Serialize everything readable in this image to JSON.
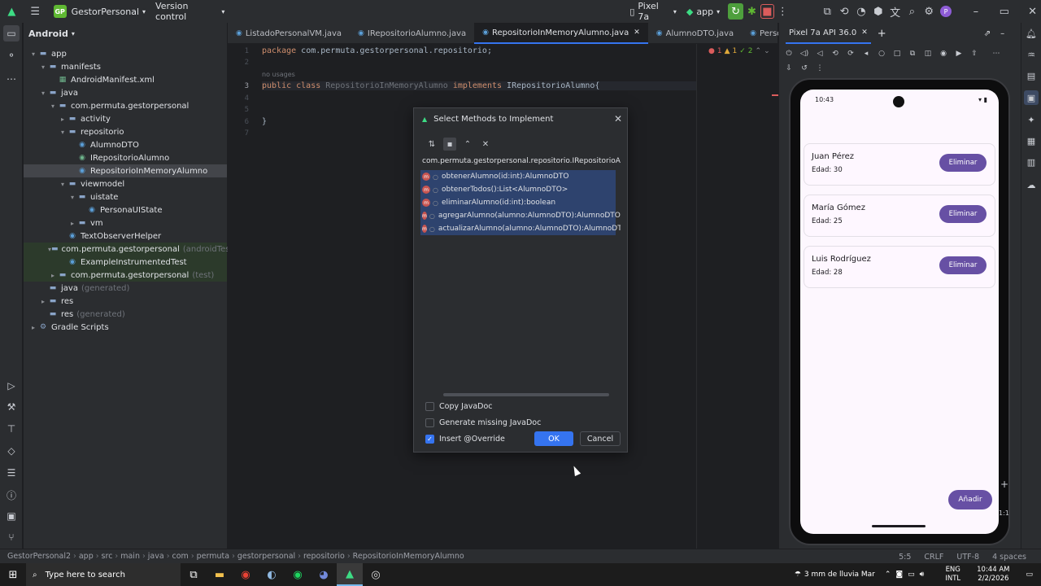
{
  "titlebar": {
    "project_badge": "GP",
    "project": "GestorPersonal",
    "vcs": "Version control",
    "device": "Pixel 7a",
    "run_config": "app",
    "avatar": "P"
  },
  "project_panel": {
    "view": "Android",
    "tree": [
      {
        "label": "app",
        "suffix": "",
        "indent": 0,
        "arrow": "▾",
        "icon": "folder"
      },
      {
        "label": "manifests",
        "suffix": "",
        "indent": 1,
        "arrow": "▾",
        "icon": "folder"
      },
      {
        "label": "AndroidManifest.xml",
        "suffix": "",
        "indent": 2,
        "arrow": "",
        "icon": "manifest"
      },
      {
        "label": "java",
        "suffix": "",
        "indent": 1,
        "arrow": "▾",
        "icon": "folder"
      },
      {
        "label": "com.permuta.gestorpersonal",
        "suffix": "",
        "indent": 2,
        "arrow": "▾",
        "icon": "folder"
      },
      {
        "label": "activity",
        "suffix": "",
        "indent": 3,
        "arrow": "▸",
        "icon": "folder"
      },
      {
        "label": "repositorio",
        "suffix": "",
        "indent": 3,
        "arrow": "▾",
        "icon": "folder"
      },
      {
        "label": "AlumnoDTO",
        "suffix": "",
        "indent": 4,
        "arrow": "",
        "icon": "class"
      },
      {
        "label": "IRepositorioAlumno",
        "suffix": "",
        "indent": 4,
        "arrow": "",
        "icon": "interface"
      },
      {
        "label": "RepositorioInMemoryAlumno",
        "suffix": "",
        "indent": 4,
        "arrow": "",
        "icon": "class",
        "selected": true
      },
      {
        "label": "viewmodel",
        "suffix": "",
        "indent": 3,
        "arrow": "▾",
        "icon": "folder"
      },
      {
        "label": "uistate",
        "suffix": "",
        "indent": 4,
        "arrow": "▾",
        "icon": "folder"
      },
      {
        "label": "PersonaUIState",
        "suffix": "",
        "indent": 5,
        "arrow": "",
        "icon": "class"
      },
      {
        "label": "vm",
        "suffix": "",
        "indent": 4,
        "arrow": "▸",
        "icon": "folder"
      },
      {
        "label": "TextObserverHelper",
        "suffix": "",
        "indent": 3,
        "arrow": "",
        "icon": "class"
      },
      {
        "label": "com.permuta.gestorpersonal",
        "suffix": "(androidTest)",
        "indent": 2,
        "arrow": "▾",
        "icon": "folder",
        "test": true
      },
      {
        "label": "ExampleInstrumentedTest",
        "suffix": "",
        "indent": 3,
        "arrow": "",
        "icon": "class",
        "test": true
      },
      {
        "label": "com.permuta.gestorpersonal",
        "suffix": "(test)",
        "indent": 2,
        "arrow": "▸",
        "icon": "folder",
        "test": true
      },
      {
        "label": "java",
        "suffix": "(generated)",
        "indent": 1,
        "arrow": "",
        "icon": "folder"
      },
      {
        "label": "res",
        "suffix": "",
        "indent": 1,
        "arrow": "▸",
        "icon": "folder"
      },
      {
        "label": "res",
        "suffix": "(generated)",
        "indent": 1,
        "arrow": "",
        "icon": "folder"
      },
      {
        "label": "Gradle Scripts",
        "suffix": "",
        "indent": 0,
        "arrow": "▸",
        "icon": "gradle"
      }
    ]
  },
  "editor": {
    "tabs": [
      "ListadoPersonalVM.java",
      "IRepositorioAlumno.java",
      "RepositorioInMemoryAlumno.java",
      "AlumnoDTO.java",
      "PersonaU"
    ],
    "active_tab": 2,
    "line_numbers": [
      "1",
      "2",
      "",
      "3",
      "4",
      "5",
      "6",
      "7"
    ],
    "code": {
      "line1_kw": "package",
      "line1_rest": " com.permuta.gestorpersonal.repositorio;",
      "usages": "no usages",
      "line3_kw1": "public class",
      "line3_name": " RepositorioInMemoryAlumno",
      "line3_kw2": " implements",
      "line3_iface": " IRepositorioAlumno{",
      "line6": "}"
    },
    "inspections": {
      "errors": "1",
      "warnings": "1",
      "weak": "2"
    }
  },
  "dialog": {
    "title": "Select Methods to Implement",
    "root": "com.permuta.gestorpersonal.repositorio.IRepositorioAlumno",
    "methods": [
      "obtenerAlumno(id:int):AlumnoDTO",
      "obtenerTodos():List<AlumnoDTO>",
      "eliminarAlumno(id:int):boolean",
      "agregarAlumno(alumno:AlumnoDTO):AlumnoDTO",
      "actualizarAlumno(alumno:AlumnoDTO):AlumnoDTO"
    ],
    "copy_javadoc": "Copy JavaDoc",
    "generate_javadoc": "Generate missing JavaDoc",
    "insert_override": "Insert @Override",
    "insert_override_checked": true,
    "ok": "OK",
    "cancel": "Cancel"
  },
  "emulator": {
    "tab": "Pixel 7a API 36.0",
    "status_time": "10:43",
    "people": [
      {
        "name": "Juan Pérez",
        "age": "Edad: 30",
        "action": "Eliminar"
      },
      {
        "name": "María Gómez",
        "age": "Edad: 25",
        "action": "Eliminar"
      },
      {
        "name": "Luis Rodríguez",
        "age": "Edad: 28",
        "action": "Eliminar"
      }
    ],
    "add_button": "Añadir",
    "zoom": "1:1"
  },
  "breadcrumb": [
    "GestorPersonal2",
    "app",
    "src",
    "main",
    "java",
    "com",
    "permuta",
    "gestorpersonal",
    "repositorio",
    "RepositorioInMemoryAlumno"
  ],
  "statusbar": {
    "position": "5:5",
    "line_sep": "CRLF",
    "encoding": "UTF-8",
    "indent": "4 spaces"
  },
  "taskbar": {
    "search_placeholder": "Type here to search",
    "weather": "3 mm de lluvia Mar",
    "lang1": "ENG",
    "lang2": "INTL",
    "time": "10:44 AM",
    "date": "2/2/2026"
  },
  "colors": {
    "accent": "#3574f0",
    "phone_button": "#6750a4",
    "error": "#c75450"
  }
}
